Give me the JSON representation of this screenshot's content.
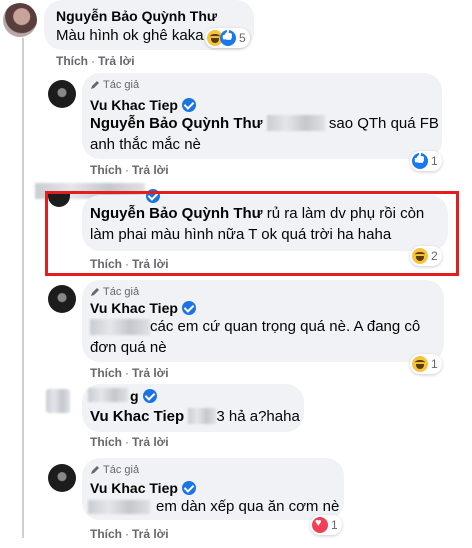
{
  "comments": [
    {
      "name": "Nguyễn Bảo Quỳnh Thư",
      "text": "Màu hình ok ghê kaka",
      "reaction_count": "5",
      "actions": {
        "like": "Thích",
        "reply": "Trả lời"
      }
    },
    {
      "author_tag": "Tác giả",
      "name": "Vu Khac Tiep",
      "mention": "Nguyễn Bảo Quỳnh Thư",
      "text_after_mention": "sao QTh quá FB",
      "text_line2": "anh thắc mắc nè",
      "reaction_count": "1",
      "actions": {
        "like": "Thích",
        "reply": "Trả lời"
      }
    },
    {
      "mention": "Nguyễn Bảo Quỳnh Thư",
      "text_after_mention": "rủ ra làm dv phụ rồi còn",
      "text_line2": "làm phai màu hình nữa T ok quá trời ha haha",
      "reaction_count": "2",
      "actions": {
        "like": "Thích",
        "reply": "Trả lời"
      }
    },
    {
      "author_tag": "Tác giả",
      "name": "Vu Khac Tiep",
      "text_line1": "các em cứ quan trọng quá nè. A đang cô",
      "text_line2": "đơn quá nè",
      "reaction_count": "1",
      "actions": {
        "like": "Thích",
        "reply": "Trả lời"
      }
    },
    {
      "name_partial": "g",
      "mention": "Vu Khac Tiep",
      "text_after_mention": "3 hả a?haha",
      "actions": {
        "like": "Thích",
        "reply": "Trả lời"
      }
    },
    {
      "author_tag": "Tác giả",
      "name": "Vu Khac Tiep",
      "text_line1": "em dàn xếp qua ăn cơm nè",
      "reaction_count": "1",
      "actions": {
        "like": "Thích",
        "reply": "Trả lời"
      }
    }
  ],
  "colors": {
    "highlight": "#e41e1e",
    "bubble": "#f0f2f5",
    "meta": "#65676b",
    "verified": "#1b74e4"
  }
}
